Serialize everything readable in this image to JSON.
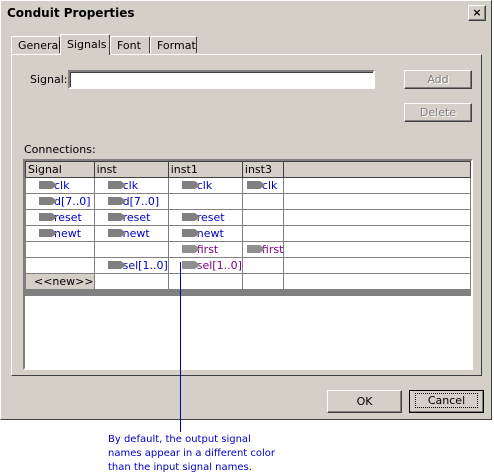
{
  "window": {
    "title": "Conduit Properties",
    "close_glyph": "×"
  },
  "tabs": [
    {
      "label": "General"
    },
    {
      "label": "Signals"
    },
    {
      "label": "Font"
    },
    {
      "label": "Format"
    }
  ],
  "signal": {
    "label": "Signal:",
    "value": ""
  },
  "buttons": {
    "add": "Add",
    "delete": "Delete",
    "ok": "OK",
    "cancel": "Cancel"
  },
  "connections": {
    "label": "Connections:",
    "columns": [
      "Signal",
      "inst",
      "inst1",
      "inst3"
    ],
    "rows": [
      [
        "clk",
        "clk",
        "clk",
        "clk"
      ],
      [
        "d[7..0]",
        "d[7..0]",
        "",
        ""
      ],
      [
        "reset",
        "reset",
        "reset",
        ""
      ],
      [
        "newt",
        "newt",
        "newt",
        ""
      ],
      [
        "",
        "",
        "first",
        "first"
      ],
      [
        "",
        "sel[1..0]",
        "sel[1..0]",
        ""
      ]
    ],
    "new_row_label": "<<new>>"
  },
  "callout": {
    "lines": [
      "By default, the output signal",
      "names appear in a different color",
      "than the input signal names."
    ]
  },
  "colors": {
    "input_signal": "#0000c0",
    "output_signal": "#800080",
    "dialog_face": "#d4d0c8"
  }
}
